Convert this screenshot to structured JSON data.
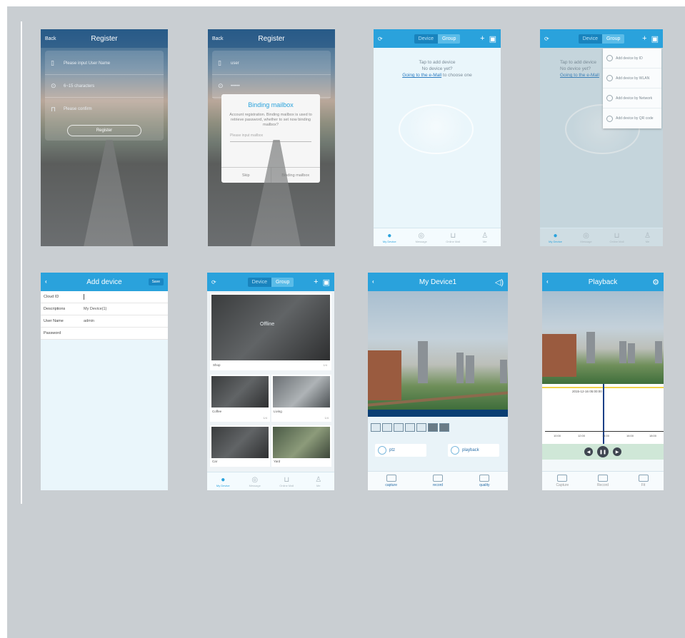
{
  "screens": {
    "register1": {
      "back": "Back",
      "title": "Register",
      "fields": [
        "Please input User Name",
        "6~15 characters",
        "Please confirm"
      ],
      "button": "Register"
    },
    "register2": {
      "back": "Back",
      "title": "Register",
      "fields": [
        "user",
        "••••••"
      ],
      "dialog": {
        "title": "Binding mailbox",
        "message": "Account registration. Binding mailbox is used to retrieve password, whether to set now binding mailbox?",
        "input_placeholder": "Please input mailbox",
        "skip": "Skip",
        "confirm": "Binding mailbox"
      }
    },
    "device_empty": {
      "tabs": [
        "Device",
        "Group"
      ],
      "empty_line1": "Tap to add device",
      "empty_line2": "No device yet?",
      "link": "Going to the e-Mall",
      "link_tail": " to choose one"
    },
    "device_menu": {
      "tabs": [
        "Device",
        "Group"
      ],
      "empty_line1": "Tap to add device",
      "empty_line2": "No device yet?",
      "link": "Going to the e-Mall",
      "menu": [
        "Add device by ID",
        "Add device by WLAN",
        "Add device by Network",
        "Add device by QR code"
      ]
    },
    "add_device": {
      "title": "Add device",
      "save": "Save",
      "rows": [
        {
          "label": "Cloud ID",
          "value": ""
        },
        {
          "label": "Descriptions",
          "value": "My Device(1)"
        },
        {
          "label": "User Name",
          "value": "admin"
        },
        {
          "label": "Password",
          "value": ""
        }
      ]
    },
    "device_grid": {
      "tabs": [
        "Device",
        "Group"
      ],
      "offline": "Offline",
      "cards": [
        {
          "name": "Shop",
          "meta": "1/4"
        },
        {
          "name": "Coffee",
          "meta": "1/4"
        },
        {
          "name": "Living",
          "meta": "1/4"
        },
        {
          "name": "Car",
          "meta": ""
        },
        {
          "name": "Yard",
          "meta": ""
        }
      ]
    },
    "live_view": {
      "title": "My Device1",
      "ptz": "ptz",
      "playback": "playback",
      "actions": [
        "capture",
        "record",
        "quality"
      ]
    },
    "playback_view": {
      "title": "Playback",
      "date": "2015-12-16 05:00:00",
      "ticks": [
        "10:00",
        "12:00",
        "14:00",
        "16:00",
        "18:00"
      ],
      "actions": [
        "Capture",
        "Record",
        "Fit"
      ]
    }
  },
  "tabbar": [
    "My Device",
    "Message",
    "Online Mall",
    "Me"
  ],
  "colors": {
    "accent": "#2aa2dc",
    "board": "#c9ced2",
    "panel": "#eaf6fb"
  }
}
